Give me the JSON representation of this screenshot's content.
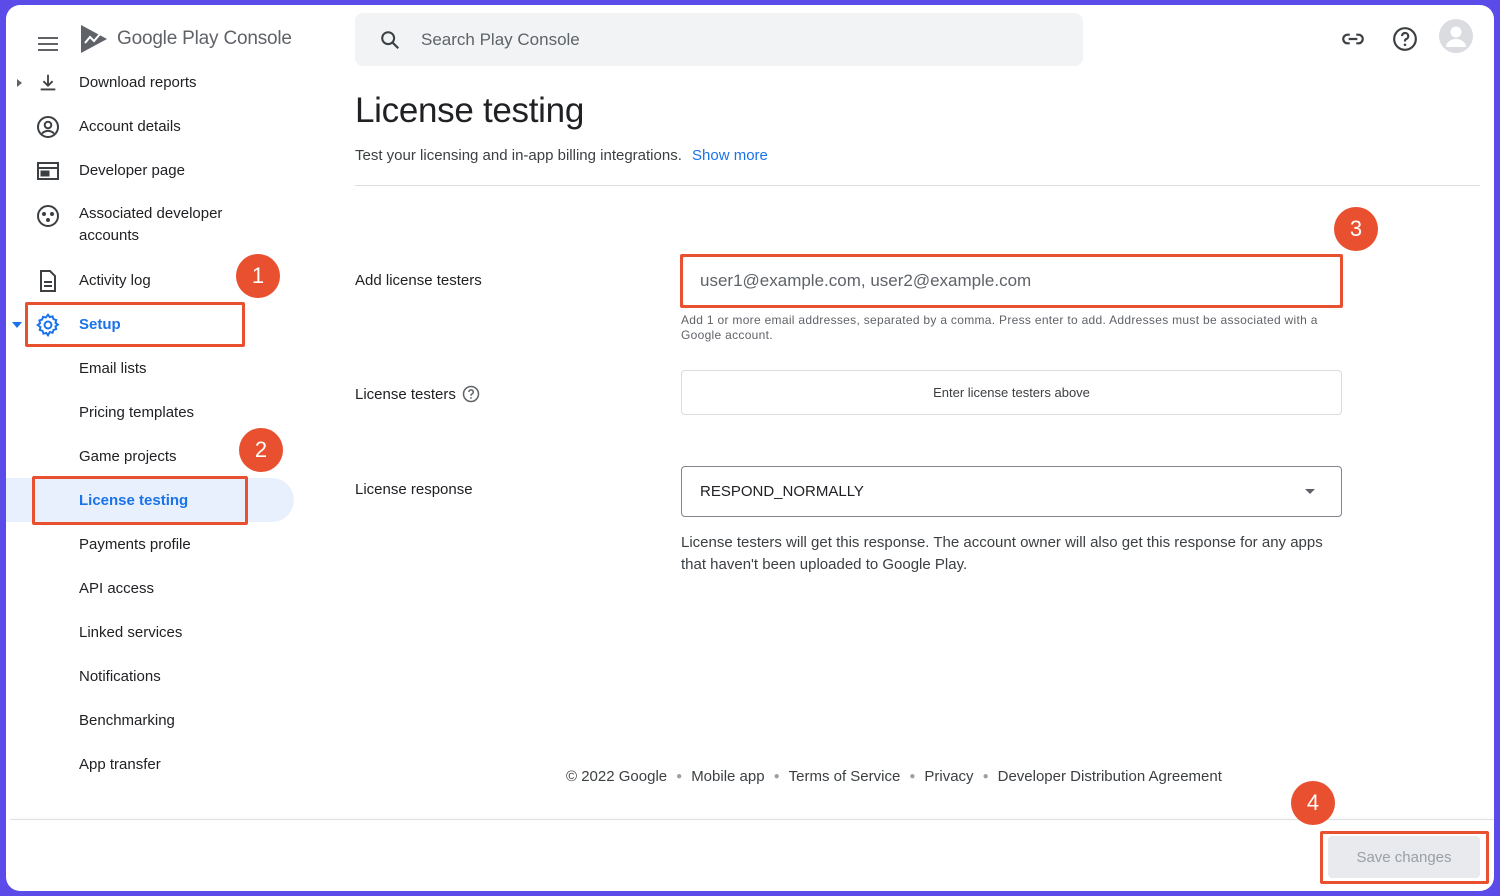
{
  "app": {
    "logo_text_google": "Google",
    "logo_text_play": "Play",
    "logo_text_console": "Console"
  },
  "search": {
    "placeholder": "Search Play Console"
  },
  "sidebar": {
    "items": [
      {
        "label": "Download reports",
        "icon": "download-icon"
      },
      {
        "label": "Account details",
        "icon": "account-circle-icon"
      },
      {
        "label": "Developer page",
        "icon": "web-page-icon"
      },
      {
        "label": "Associated developer accounts",
        "icon": "linked-accounts-icon"
      },
      {
        "label": "Activity log",
        "icon": "document-icon"
      },
      {
        "label": "Setup",
        "icon": "gear-icon"
      }
    ],
    "setup_children": [
      {
        "label": "Email lists"
      },
      {
        "label": "Pricing templates"
      },
      {
        "label": "Game projects"
      },
      {
        "label": "License testing"
      },
      {
        "label": "Payments profile"
      },
      {
        "label": "API access"
      },
      {
        "label": "Linked services"
      },
      {
        "label": "Notifications"
      },
      {
        "label": "Benchmarking"
      },
      {
        "label": "App transfer"
      }
    ]
  },
  "main": {
    "title": "License testing",
    "description": "Test your licensing and in-app billing integrations.",
    "show_more": "Show more",
    "add_testers_label": "Add license testers",
    "email_placeholder": "user1@example.com, user2@example.com",
    "email_helper": "Add 1 or more email addresses, separated by a comma. Press enter to add. Addresses must be associated with a Google account.",
    "testers_label": "License testers",
    "testers_empty": "Enter license testers above",
    "response_label": "License response",
    "response_value": "RESPOND_NORMALLY",
    "response_help": "License testers will get this response. The account owner will also get this response for any apps that haven't been uploaded to Google Play."
  },
  "footer": {
    "copyright": "© 2022 Google",
    "links": [
      "Mobile app",
      "Terms of Service",
      "Privacy",
      "Developer Distribution Agreement"
    ]
  },
  "actions": {
    "save_label": "Save changes"
  },
  "annotations": [
    "1",
    "2",
    "3",
    "4"
  ],
  "colors": {
    "accent": "#1a73e8",
    "annotation": "#e8502f",
    "selected_bg": "#e8f0fe",
    "frame": "#5b4be8"
  }
}
